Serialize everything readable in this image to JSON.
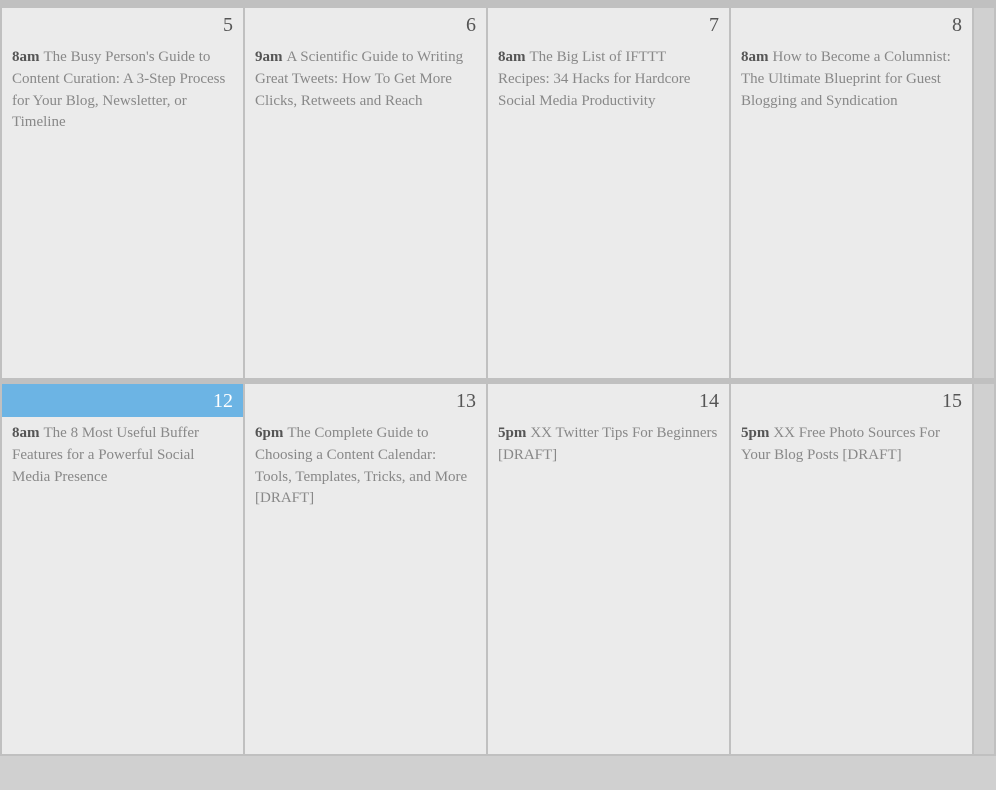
{
  "calendar": {
    "week1": {
      "cells": [
        {
          "day": "5",
          "active": false,
          "events": [
            {
              "time": "8am",
              "title": "The Busy Person's Guide to Content Curation: A 3-Step Process for Your Blog, Newsletter, or Timeline"
            }
          ]
        },
        {
          "day": "6",
          "active": false,
          "events": [
            {
              "time": "9am",
              "title": "A Scientific Guide to Writing Great Tweets: How To Get More Clicks, Retweets and Reach"
            }
          ]
        },
        {
          "day": "7",
          "active": false,
          "events": [
            {
              "time": "8am",
              "title": "The Big List of IFTTT Recipes: 34 Hacks for Hardcore Social Media Productivity"
            }
          ]
        },
        {
          "day": "8",
          "active": false,
          "events": [
            {
              "time": "8am",
              "title": "How to Become a Columnist: The Ultimate Blueprint for Guest Blogging and Syndication"
            }
          ]
        }
      ]
    },
    "week2": {
      "cells": [
        {
          "day": "12",
          "active": true,
          "events": [
            {
              "time": "8am",
              "title": "The 8 Most Useful Buffer Features for a Powerful Social Media Presence"
            }
          ]
        },
        {
          "day": "13",
          "active": false,
          "events": [
            {
              "time": "6pm",
              "title": "The Complete Guide to Choosing a Content Calendar: Tools, Templates, Tricks, and More [DRAFT]"
            }
          ]
        },
        {
          "day": "14",
          "active": false,
          "events": [
            {
              "time": "5pm",
              "title": "XX Twitter Tips For Beginners [DRAFT]"
            }
          ]
        },
        {
          "day": "15",
          "active": false,
          "events": [
            {
              "time": "5pm",
              "title": "XX Free Photo Sources For Your Blog Posts [DRAFT]"
            }
          ]
        }
      ]
    }
  }
}
